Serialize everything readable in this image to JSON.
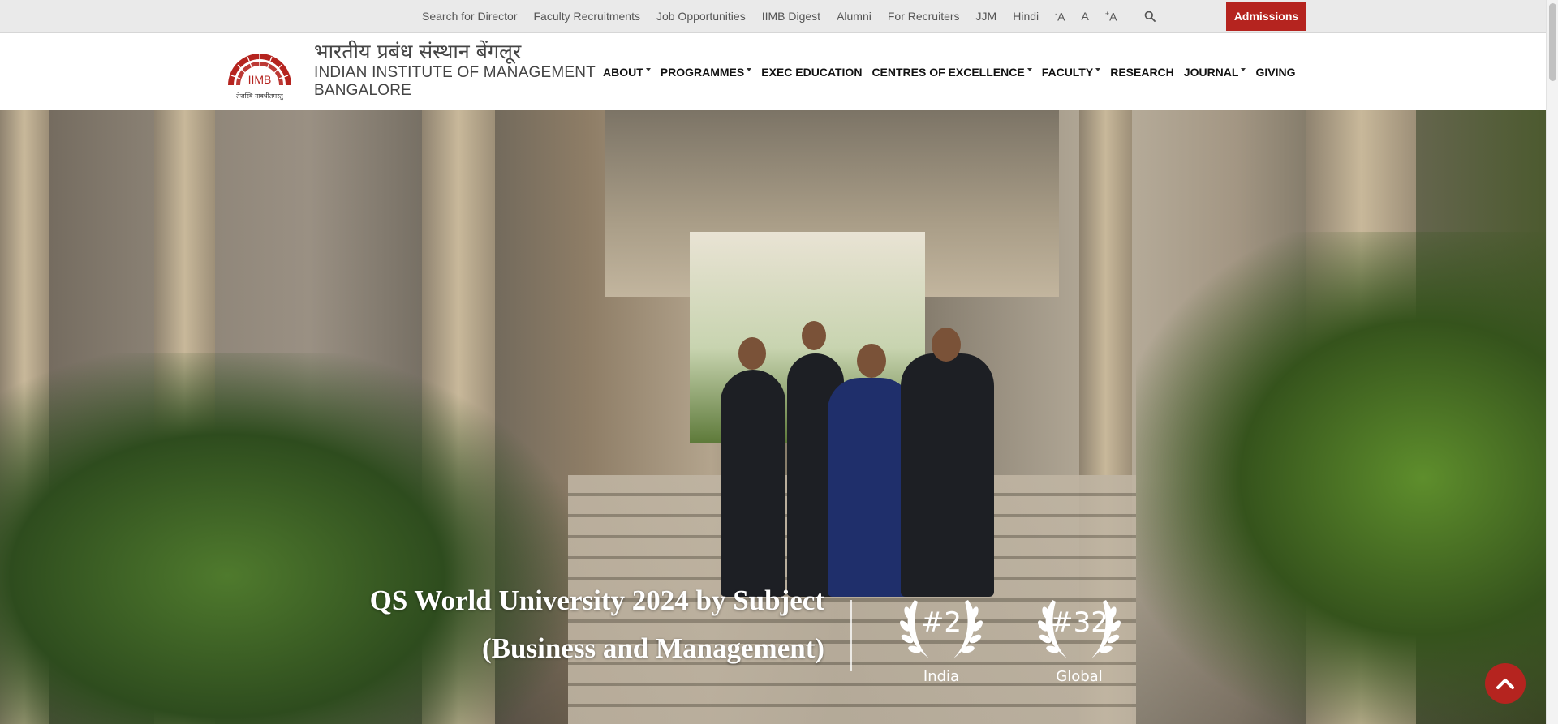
{
  "topbar": {
    "links": [
      "Search for Director",
      "Faculty Recruitments",
      "Job Opportunities",
      "IIMB Digest",
      "Alumni",
      "For Recruiters",
      "JJM",
      "Hindi"
    ],
    "font_size_controls": {
      "decrease": "A",
      "normal": "A",
      "increase": "A",
      "decrease_prefix": "-",
      "increase_prefix": "+"
    },
    "search_icon": "search-icon",
    "admissions_label": "Admissions"
  },
  "header": {
    "logo_mark_text": "IIMB",
    "logo_motto": "तेजस्वि नावधीतमस्तु",
    "logo_hindi": "भारतीय प्रबंध संस्थान बेंगलूर",
    "logo_line1": "INDIAN INSTITUTE OF MANAGEMENT",
    "logo_line2": "BANGALORE",
    "nav": [
      {
        "label": "ABOUT",
        "dropdown": true
      },
      {
        "label": "PROGRAMMES",
        "dropdown": true
      },
      {
        "label": "EXEC EDUCATION",
        "dropdown": false
      },
      {
        "label": "CENTRES OF EXCELLENCE",
        "dropdown": true
      },
      {
        "label": "FACULTY",
        "dropdown": true
      },
      {
        "label": "RESEARCH",
        "dropdown": false
      },
      {
        "label": "JOURNAL",
        "dropdown": true
      },
      {
        "label": "GIVING",
        "dropdown": false
      }
    ]
  },
  "hero": {
    "title_line1": "QS World University 2024 by Subject",
    "title_line2": "(Business and Management)",
    "ranks": [
      {
        "value": "#2",
        "label": "India"
      },
      {
        "value": "#32",
        "label": "Global"
      }
    ]
  },
  "colors": {
    "brand_red": "#b5241f",
    "topbar_bg": "#eaeaea",
    "nav_text": "#111111"
  }
}
